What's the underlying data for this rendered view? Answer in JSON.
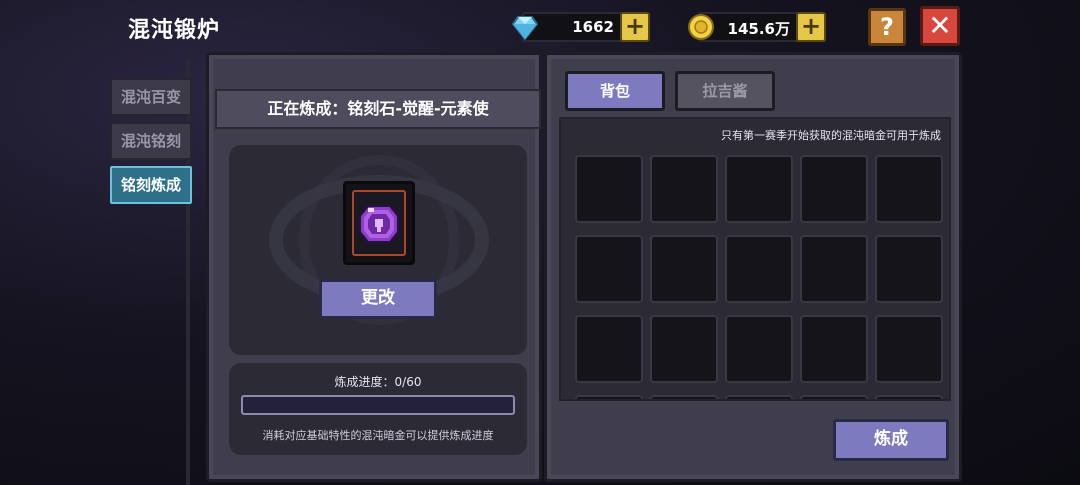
{
  "header": {
    "title": "混沌锻炉",
    "diamonds": "1662",
    "gold": "145.6万",
    "help_label": "?",
    "close_label": "✕"
  },
  "side_tabs": [
    {
      "label": "混沌百变",
      "active": false
    },
    {
      "label": "混沌铭刻",
      "active": false
    },
    {
      "label": "铭刻炼成",
      "active": true
    }
  ],
  "forge": {
    "header": "正在炼成：铭刻石-觉醒-元素使",
    "item_icon": "purple-gem-icon",
    "change_label": "更改",
    "progress_label": "炼成进度：0/60",
    "progress_current": 0,
    "progress_max": 60,
    "hint": "消耗对应基础特性的混沌暗金可以提供炼成进度"
  },
  "inventory": {
    "tabs": [
      "背包",
      "拉吉酱"
    ],
    "active_tab": "背包",
    "note": "只有第一赛季开始获取的混沌暗金可用于炼成",
    "forge_label": "炼成"
  },
  "colors": {
    "accent": "#7d7ac0",
    "active_side_tab": "#2e6f8a",
    "plus": "#e7c74a",
    "help": "#c9853a",
    "close": "#d7473d"
  }
}
